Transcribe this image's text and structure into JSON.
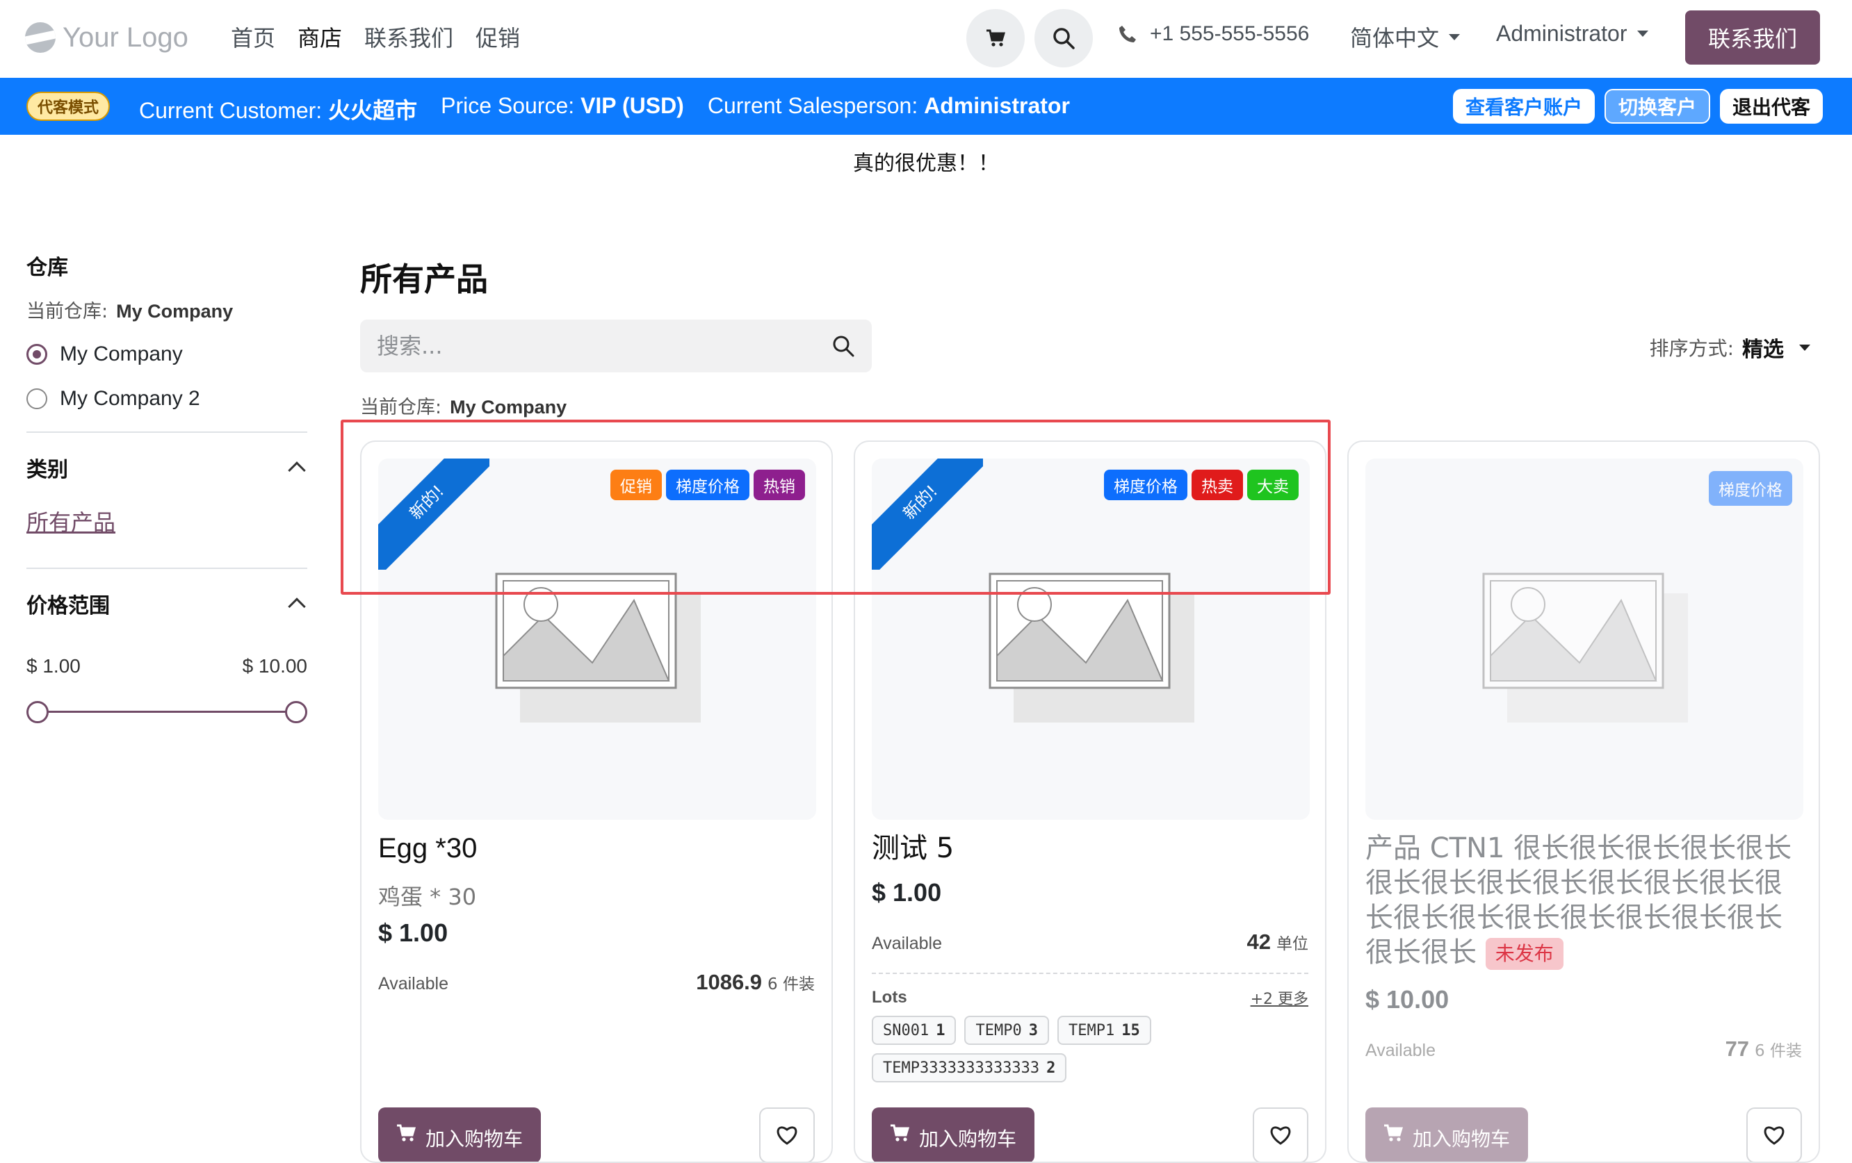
{
  "header": {
    "logo_text": "Your Logo",
    "nav": [
      "首页",
      "商店",
      "联系我们",
      "促销"
    ],
    "phone": "+1 555-555-5556",
    "language": "简体中文",
    "user": "Administrator",
    "contact_button": "联系我们"
  },
  "agent_bar": {
    "mode_badge": "代客模式",
    "customer_label": "Current Customer:",
    "customer_value": "火火超市",
    "price_label": "Price Source:",
    "price_value": "VIP (USD)",
    "salesperson_label": "Current Salesperson:",
    "salesperson_value": "Administrator",
    "btn_view_account": "查看客户账户",
    "btn_switch": "切换客户",
    "btn_exit": "退出代客"
  },
  "announcement": "真的很优惠！！",
  "sidebar": {
    "warehouse_title": "仓库",
    "current_label": "当前仓库:",
    "current_value": "My Company",
    "warehouses": [
      "My Company",
      "My Company 2"
    ],
    "category_title": "类别",
    "category_link": "所有产品",
    "price_title": "价格范围",
    "price_min": "$ 1.00",
    "price_max": "$ 10.00"
  },
  "main": {
    "title": "所有产品",
    "search_placeholder": "搜索...",
    "sort_label": "排序方式:",
    "sort_value": "精选",
    "current_label": "当前仓库:",
    "current_value": "My Company"
  },
  "products": [
    {
      "ribbon": "新的!",
      "tags": [
        {
          "label": "促销",
          "color": "#fd7e14"
        },
        {
          "label": "梯度价格",
          "color": "#0d6efd"
        },
        {
          "label": "热销",
          "color": "#8e1f8e"
        }
      ],
      "name": "Egg *30",
      "desc": "鸡蛋 * 30",
      "price": "$ 1.00",
      "available_label": "Available",
      "qty": "1086.9",
      "unit": "6 件装",
      "cart_label": "加入购物车"
    },
    {
      "ribbon": "新的!",
      "tags": [
        {
          "label": "梯度价格",
          "color": "#0d6efd"
        },
        {
          "label": "热卖",
          "color": "#e01b1b"
        },
        {
          "label": "大卖",
          "color": "#1fc41f"
        }
      ],
      "name": "测试 5",
      "price": "$ 1.00",
      "available_label": "Available",
      "qty": "42",
      "unit": "单位",
      "lots_title": "Lots",
      "lots_more": "+2 更多",
      "lots": [
        {
          "code": "SN001",
          "qty": "1"
        },
        {
          "code": "TEMP0",
          "qty": "3"
        },
        {
          "code": "TEMP1",
          "qty": "15"
        },
        {
          "code": "TEMP3333333333333",
          "qty": "2"
        }
      ],
      "cart_label": "加入购物车"
    },
    {
      "tags": [
        {
          "label": "梯度价格",
          "color": "#0d6efd"
        }
      ],
      "name": "产品 CTN1 很长很长很长很长很长很长很长很长很长很长很长很长很长很长很长很长很长很长很长很长很长很长",
      "unpublished": "未发布",
      "price": "$ 10.00",
      "available_label": "Available",
      "qty": "77",
      "unit": "6 件装",
      "cart_label": "加入购物车"
    }
  ]
}
